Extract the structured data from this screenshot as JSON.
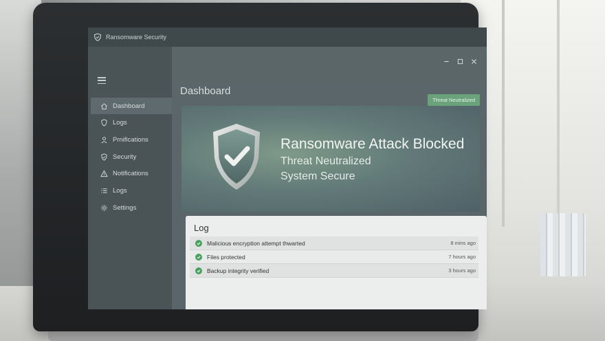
{
  "window": {
    "app_title": "Ransomware Security"
  },
  "sidebar": {
    "items": [
      {
        "label": "Dashboard",
        "icon": "home-icon",
        "active": true
      },
      {
        "label": "Logs",
        "icon": "shield-icon",
        "active": false
      },
      {
        "label": "Prnifications",
        "icon": "user-icon",
        "active": false
      },
      {
        "label": "Security",
        "icon": "shield-icon",
        "active": false
      },
      {
        "label": "Notifications",
        "icon": "warning-icon",
        "active": false
      },
      {
        "label": "Logs",
        "icon": "list-icon",
        "active": false
      },
      {
        "label": "Settings",
        "icon": "gear-icon",
        "active": false
      }
    ]
  },
  "main": {
    "title": "Dashboard",
    "status_badge": "Threat Neutralized",
    "hero": {
      "title": "Ransomware Attack Blocked",
      "line1": "Threat Neutralized",
      "line2": "System Secure"
    },
    "log": {
      "title": "Log",
      "rows": [
        {
          "text": "Malicious encryption attempt thwarted",
          "time": "8 mins ago"
        },
        {
          "text": "Files protected",
          "time": "7 hours ago"
        },
        {
          "text": "Backup integrity verified",
          "time": "3 hours ago"
        }
      ]
    }
  },
  "colors": {
    "accent_green": "#6aa37b",
    "check_green": "#49a15f",
    "sidebar_bg": "#4a5457",
    "main_bg": "#5b6669"
  }
}
